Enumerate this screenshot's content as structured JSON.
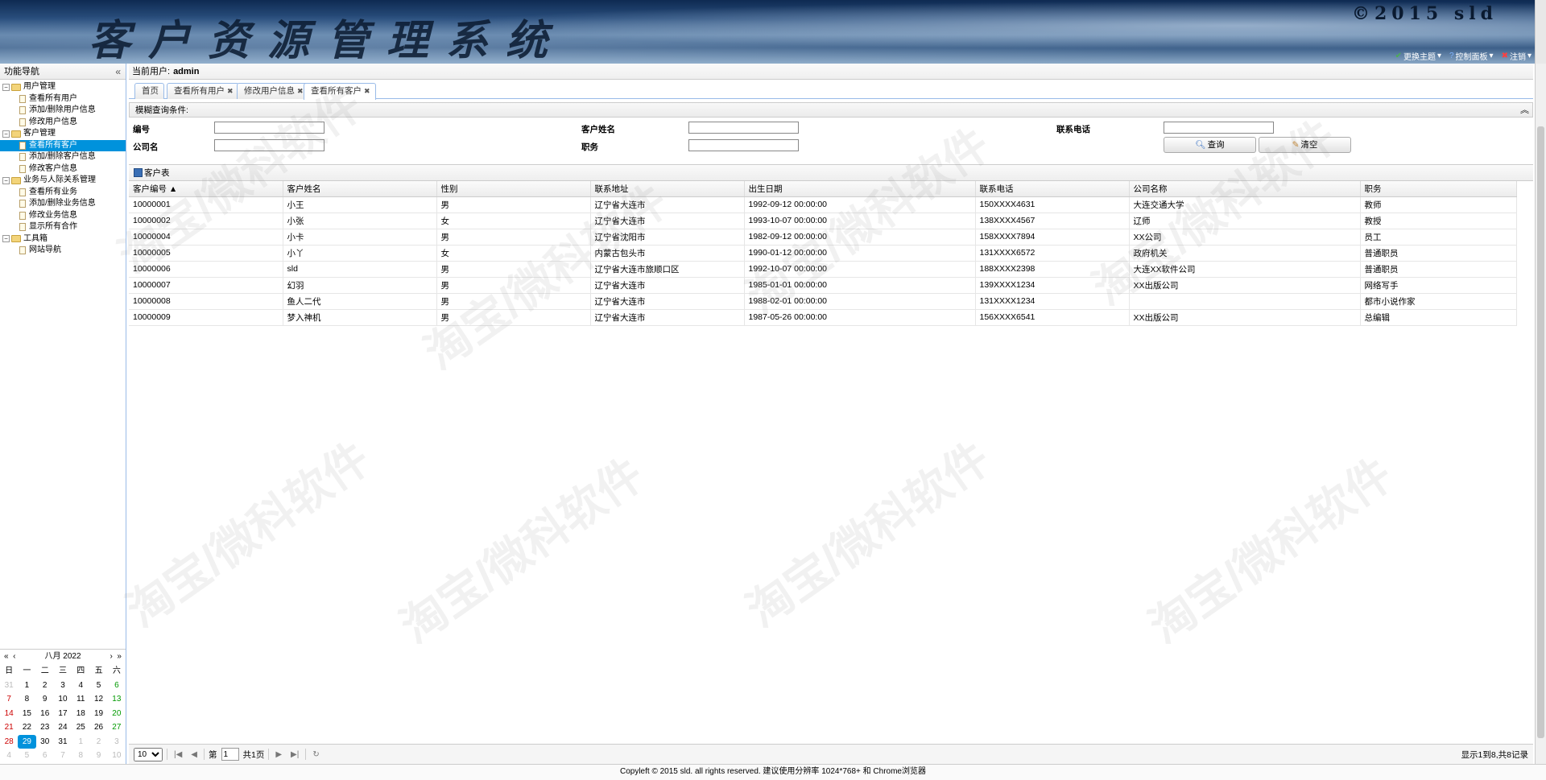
{
  "banner": {
    "title": "客户资源管理系统",
    "copyright": "©2015 sld",
    "menu": [
      {
        "label": "更换主题",
        "icon": "check-icon"
      },
      {
        "label": "控制面板",
        "icon": "help-icon"
      },
      {
        "label": "注销",
        "icon": "close-icon"
      }
    ]
  },
  "west": {
    "title": "功能导航",
    "collapse": "«",
    "tree": [
      {
        "label": "用户管理",
        "type": "folder",
        "level": 0
      },
      {
        "label": "查看所有用户",
        "type": "file",
        "level": 1
      },
      {
        "label": "添加/删除用户信息",
        "type": "file",
        "level": 1
      },
      {
        "label": "修改用户信息",
        "type": "file",
        "level": 1
      },
      {
        "label": "客户管理",
        "type": "folder",
        "level": 0
      },
      {
        "label": "查看所有客户",
        "type": "file",
        "level": 1,
        "selected": true
      },
      {
        "label": "添加/删除客户信息",
        "type": "file",
        "level": 1
      },
      {
        "label": "修改客户信息",
        "type": "file",
        "level": 1
      },
      {
        "label": "业务与人际关系管理",
        "type": "folder",
        "level": 0
      },
      {
        "label": "查看所有业务",
        "type": "file",
        "level": 1
      },
      {
        "label": "添加/删除业务信息",
        "type": "file",
        "level": 1
      },
      {
        "label": "修改业务信息",
        "type": "file",
        "level": 1
      },
      {
        "label": "显示所有合作",
        "type": "file",
        "level": 1
      },
      {
        "label": "工具箱",
        "type": "folder",
        "level": 0
      },
      {
        "label": "网站导航",
        "type": "file",
        "level": 1
      }
    ]
  },
  "calendar": {
    "month_label": "八月 2022",
    "weekdays": [
      "日",
      "一",
      "二",
      "三",
      "四",
      "五",
      "六"
    ],
    "days": [
      [
        "31",
        "1",
        "2",
        "3",
        "4",
        "5",
        "6"
      ],
      [
        "7",
        "8",
        "9",
        "10",
        "11",
        "12",
        "13"
      ],
      [
        "14",
        "15",
        "16",
        "17",
        "18",
        "19",
        "20"
      ],
      [
        "21",
        "22",
        "23",
        "24",
        "25",
        "26",
        "27"
      ],
      [
        "28",
        "29",
        "30",
        "31",
        "1",
        "2",
        "3"
      ],
      [
        "4",
        "5",
        "6",
        "7",
        "8",
        "9",
        "10"
      ]
    ],
    "today": "29"
  },
  "center": {
    "current_user_label": "当前用户:",
    "current_user": "admin",
    "tabs": [
      {
        "label": "首页",
        "closable": false
      },
      {
        "label": "查看所有用户",
        "closable": true
      },
      {
        "label": "修改用户信息",
        "closable": true
      },
      {
        "label": "查看所有客户",
        "closable": true,
        "active": true
      }
    ]
  },
  "query": {
    "title": "模糊查询条件:",
    "fields": {
      "id": "编号",
      "name": "客户姓名",
      "phone": "联系电话",
      "company": "公司名",
      "position": "职务"
    },
    "search_button": "查询",
    "clear_button": "清空"
  },
  "grid": {
    "title": "客户表",
    "columns": [
      "客户编号 ▲",
      "客户姓名",
      "性别",
      "联系地址",
      "出生日期",
      "联系电话",
      "公司名称",
      "职务"
    ],
    "rows": [
      [
        "10000001",
        "小王",
        "男",
        "辽宁省大连市",
        "1992-09-12 00:00:00",
        "150XXXX4631",
        "大连交通大学",
        "教师"
      ],
      [
        "10000002",
        "小张",
        "女",
        "辽宁省大连市",
        "1993-10-07 00:00:00",
        "138XXXX4567",
        "辽师",
        "教授"
      ],
      [
        "10000004",
        "小卡",
        "男",
        "辽宁省沈阳市",
        "1982-09-12 00:00:00",
        "158XXXX7894",
        "XX公司",
        "员工"
      ],
      [
        "10000005",
        "小丫",
        "女",
        "内蒙古包头市",
        "1990-01-12 00:00:00",
        "131XXXX6572",
        "政府机关",
        "普通职员"
      ],
      [
        "10000006",
        "sld",
        "男",
        "辽宁省大连市旅顺口区",
        "1992-10-07 00:00:00",
        "188XXXX2398",
        "大连XX软件公司",
        "普通职员"
      ],
      [
        "10000007",
        "幻羽",
        "男",
        "辽宁省大连市",
        "1985-01-01 00:00:00",
        "139XXXX1234",
        "XX出版公司",
        "网络写手"
      ],
      [
        "10000008",
        "鱼人二代",
        "男",
        "辽宁省大连市",
        "1988-02-01 00:00:00",
        "131XXXX1234",
        "",
        "都市小说作家"
      ],
      [
        "10000009",
        "梦入神机",
        "男",
        "辽宁省大连市",
        "1987-05-26 00:00:00",
        "156XXXX6541",
        "XX出版公司",
        "总编辑"
      ]
    ]
  },
  "pager": {
    "page_size": "10",
    "page_prefix": "第",
    "page_value": "1",
    "page_total": "共1页",
    "info": "显示1到8,共8记录"
  },
  "footer": {
    "text": "Copyleft © 2015 sld. all rights reserved. 建议使用分辨率 1024*768+ 和 Chrome浏览器"
  },
  "watermark": "淘宝/微科软件"
}
